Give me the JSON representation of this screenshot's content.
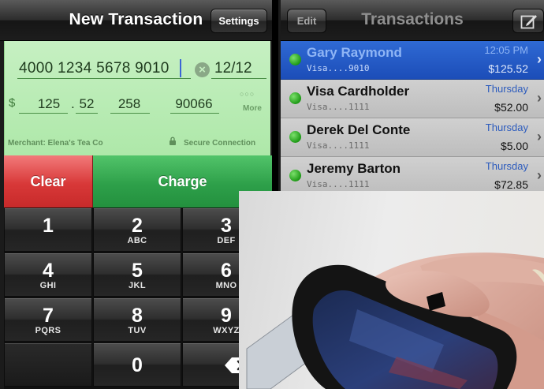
{
  "new_transaction": {
    "title": "New Transaction",
    "settings_label": "Settings",
    "card_number": "4000 1234 5678 9010",
    "expiry": "12/12",
    "currency_symbol": "$",
    "amount_dollars": "125",
    "amount_cents": "52",
    "cvv": "258",
    "zip": "90066",
    "more_label": "More",
    "merchant": "Merchant: Elena's Tea Co",
    "secure_label": "Secure Connection",
    "clear_label": "Clear",
    "charge_label": "Charge",
    "keys": [
      {
        "digit": "1",
        "letters": ""
      },
      {
        "digit": "2",
        "letters": "ABC"
      },
      {
        "digit": "3",
        "letters": "DEF"
      },
      {
        "digit": "4",
        "letters": "GHI"
      },
      {
        "digit": "5",
        "letters": "JKL"
      },
      {
        "digit": "6",
        "letters": "MNO"
      },
      {
        "digit": "7",
        "letters": "PQRS"
      },
      {
        "digit": "8",
        "letters": "TUV"
      },
      {
        "digit": "9",
        "letters": "WXYZ"
      },
      {
        "digit": "0",
        "letters": ""
      }
    ],
    "colors": {
      "field_green": "#b6eab1",
      "clear_red": "#d83838",
      "charge_green": "#2ea04a"
    }
  },
  "transactions": {
    "title": "Transactions",
    "edit_label": "Edit",
    "compose_icon": "compose-icon",
    "rows": [
      {
        "name": "Gary Raymond",
        "card": "Visa....9010",
        "time": "12:05 PM",
        "amount": "$125.52",
        "selected": true
      },
      {
        "name": "Visa Cardholder",
        "card": "Visa....1111",
        "time": "Thursday",
        "amount": "$52.00",
        "selected": false
      },
      {
        "name": "Derek Del Conte",
        "card": "Visa....1111",
        "time": "Thursday",
        "amount": "$5.00",
        "selected": false
      },
      {
        "name": "Jeremy Barton",
        "card": "Visa....1111",
        "time": "Thursday",
        "amount": "$72.85",
        "selected": false
      }
    ],
    "colors": {
      "selection_blue": "#2f6ad4",
      "status_dot": "#1e9a16"
    }
  }
}
